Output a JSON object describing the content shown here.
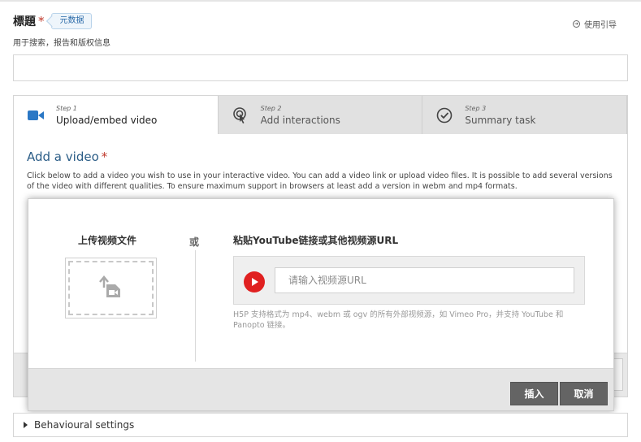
{
  "field": {
    "title_label": "標題",
    "required_mark": "*",
    "meta_badge": "元数据",
    "subtitle": "用于搜索，报告和版权信息",
    "guide_label": "使用引导",
    "title_value": ""
  },
  "tabs": [
    {
      "step": "Step 1",
      "label": "Upload/embed video",
      "icon": "video-camera-icon",
      "active": true
    },
    {
      "step": "Step 2",
      "label": "Add interactions",
      "icon": "touch-icon",
      "active": false
    },
    {
      "step": "Step 3",
      "label": "Summary task",
      "icon": "check-circle-icon",
      "active": false
    }
  ],
  "video_section": {
    "title": "Add a video",
    "required_mark": "*",
    "description": "Click below to add a video you wish to use in your interactive video. You can add a video link or upload video files. It is possible to add several versions of the video with different qualities. To ensure maximum support in browsers at least add a version in webm and mp4 formats."
  },
  "dialog": {
    "upload_title": "上传视频文件",
    "or_label": "或",
    "url_title": "粘贴YouTube链接或其他视频源URL",
    "url_placeholder": "请输入视频源URL",
    "url_hint": "H5P 支持格式为 mp4、webm 或 ogv 的所有外部视频源，如 Vimeo Pro，并支持 YouTube 和 Panopto 链接。",
    "insert_label": "插入",
    "cancel_label": "取消"
  },
  "behavioural": {
    "label": "Behavioural settings"
  },
  "colors": {
    "accent_blue": "#2b78c5",
    "required_red": "#c0392b",
    "play_red": "#e02020",
    "button_gray": "#646464"
  }
}
